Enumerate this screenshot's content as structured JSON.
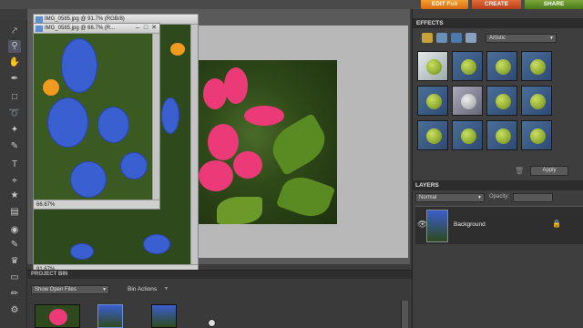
{
  "top_bar": {
    "edit_full": "EDIT Full",
    "create": "CREATE",
    "share": "SHARE"
  },
  "document_small": {
    "title": "IMG_0585.jpg @ 66.7% (R...",
    "zoom": "66.67%"
  },
  "document_large": {
    "title": "IMG_0585.jpg @ 91.7% (RGB/8)",
    "zoom": "91.67%"
  },
  "effects_panel": {
    "header": "EFFECTS",
    "category": "Artistic",
    "apply_label": "Apply"
  },
  "layers_panel": {
    "header": "LAYERS",
    "blend_mode": "Normal",
    "opacity_label": "Opacity:",
    "layer_name": "Background"
  },
  "project_bin": {
    "header": "PROJECT BIN",
    "show_dropdown": "Show Open Files",
    "bin_actions": "Bin Actions"
  },
  "colors": {
    "edit_accent": "#e8861c",
    "create_accent": "#c8502a",
    "share_accent": "#5f9228",
    "panel_bg": "#3e3e3e"
  }
}
